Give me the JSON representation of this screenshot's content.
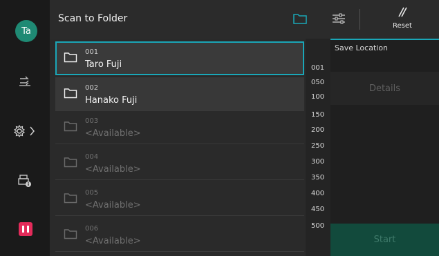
{
  "user": {
    "initials": "Ta"
  },
  "header": {
    "title": "Scan to Folder",
    "reset_label": "Reset"
  },
  "folders": [
    {
      "number": "001",
      "name": "Taro Fuji",
      "state": "selected"
    },
    {
      "number": "002",
      "name": "Hanako Fuji",
      "state": "filled"
    },
    {
      "number": "003",
      "name": "<Available>",
      "state": "empty"
    },
    {
      "number": "004",
      "name": "<Available>",
      "state": "empty"
    },
    {
      "number": "005",
      "name": "<Available>",
      "state": "empty"
    },
    {
      "number": "006",
      "name": "<Available>",
      "state": "empty"
    }
  ],
  "index": [
    "001",
    "050",
    "100",
    "150",
    "200",
    "250",
    "300",
    "350",
    "400",
    "450",
    "500"
  ],
  "panel": {
    "save_location_label": "Save Location",
    "details_label": "Details",
    "start_label": "Start"
  },
  "colors": {
    "accent": "#1aa7b8",
    "avatar": "#1f8a74",
    "pause": "#e32b5a",
    "start_bg": "#124a3c"
  }
}
